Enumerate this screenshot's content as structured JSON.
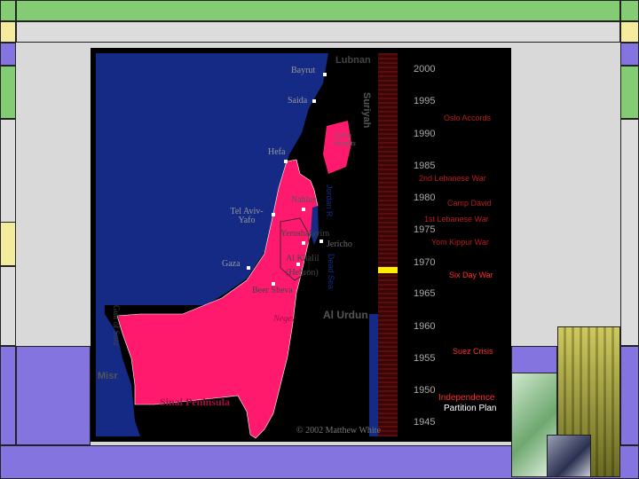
{
  "map": {
    "labels": {
      "lubnan": "Lubnan",
      "bayrut": "Bayrut",
      "saida": "Saida",
      "suriyah": "Suriyah",
      "golan": "Golan Heights",
      "hefa": "Hefa",
      "tel_aviv": "Tel Aviv-Yafo",
      "nablus": "Nablus",
      "jerusalem": "Yerushalayim",
      "jericho": "Jericho",
      "gaza": "Gaza",
      "al_khalil": "Al Khalil (Hebron)",
      "beersheva": "Beer Sheva",
      "negev": "Negev",
      "al_urdun": "Al Urdun",
      "misr": "Misr",
      "sinai": "Sinai Peninsula",
      "jordan_river": "Jordan R.",
      "dead_sea": "Dead Sea",
      "gulf_suez": "Gulf of Suez",
      "copyright": "© 2002 Matthew White"
    },
    "colors": {
      "sea": "#142a85",
      "israel": "#ff1a6e",
      "land": "#000000",
      "border": "#ffffff",
      "timeline": "#5a0d0d"
    }
  },
  "timeline": {
    "years": [
      "2000",
      "1995",
      "1990",
      "1985",
      "1980",
      "1975",
      "1970",
      "1965",
      "1960",
      "1955",
      "1950",
      "1945"
    ],
    "current_marker": "1967",
    "events": [
      {
        "label": "Oslo Accords",
        "color": "#b81a1a"
      },
      {
        "label": "2nd Lebanese War",
        "color": "#b81a1a"
      },
      {
        "label": "Camp David",
        "color": "#b81a1a"
      },
      {
        "label": "1st Lebanese War",
        "color": "#b81a1a"
      },
      {
        "label": "Yom Kippur War",
        "color": "#b81a1a"
      },
      {
        "label": "Six Day War",
        "color": "#ff2a2a"
      },
      {
        "label": "Suez Crisis",
        "color": "#ff2a2a"
      },
      {
        "label": "Independence",
        "color": "#ff2a2a"
      },
      {
        "label": "Partition Plan",
        "color": "#ffffff"
      }
    ]
  }
}
